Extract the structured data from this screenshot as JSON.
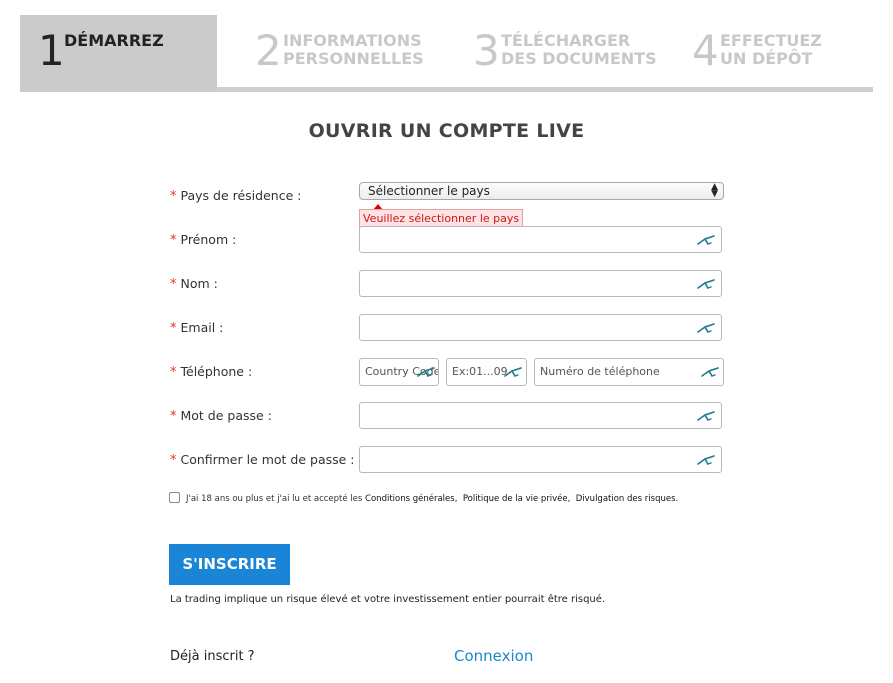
{
  "steps": [
    {
      "num": "1",
      "label_line1": "DÉMARREZ",
      "label_line2": ""
    },
    {
      "num": "2",
      "label_line1": "INFORMATIONS",
      "label_line2": "PERSONNELLES"
    },
    {
      "num": "3",
      "label_line1": "TÉLÉCHARGER",
      "label_line2": "DES DOCUMENTS"
    },
    {
      "num": "4",
      "label_line1": "EFFECTUEZ",
      "label_line2": "UN DÉPÔT"
    }
  ],
  "title": "OUVRIR UN COMPTE LIVE",
  "required_mark": "*",
  "form": {
    "country": {
      "label": "Pays de résidence :",
      "selected": "Sélectionner le pays",
      "error": "Veuillez sélectionner le pays"
    },
    "firstname": {
      "label": "Prénom :"
    },
    "lastname": {
      "label": "Nom :"
    },
    "email": {
      "label": "Email :"
    },
    "phone": {
      "label": "Téléphone :",
      "country_code_placeholder": "Country Code",
      "area_placeholder": "Ex:01...09",
      "number_placeholder": "Numéro de téléphone"
    },
    "password": {
      "label": "Mot de passe :"
    },
    "confirm_password": {
      "label": "Confirmer le mot de passe :"
    }
  },
  "terms": {
    "prefix": "J'ai 18 ans ou plus et j'ai lu et accepté les",
    "link1": "Conditions générales,",
    "link2": "Politique de la vie privée,",
    "link3": "Divulgation des risques."
  },
  "submit_label": "S'INSCRIRE",
  "risk_text": "La trading implique un risque élevé et votre investissement entier pourrait être risqué.",
  "already_text": "Déjà inscrit ?",
  "login_link": "Connexion",
  "colors": {
    "accent": "#1a84d6",
    "required": "#e0332f",
    "error": "#d01616",
    "link": "#1b88c9",
    "edit_icon": "#1e7a8c"
  }
}
